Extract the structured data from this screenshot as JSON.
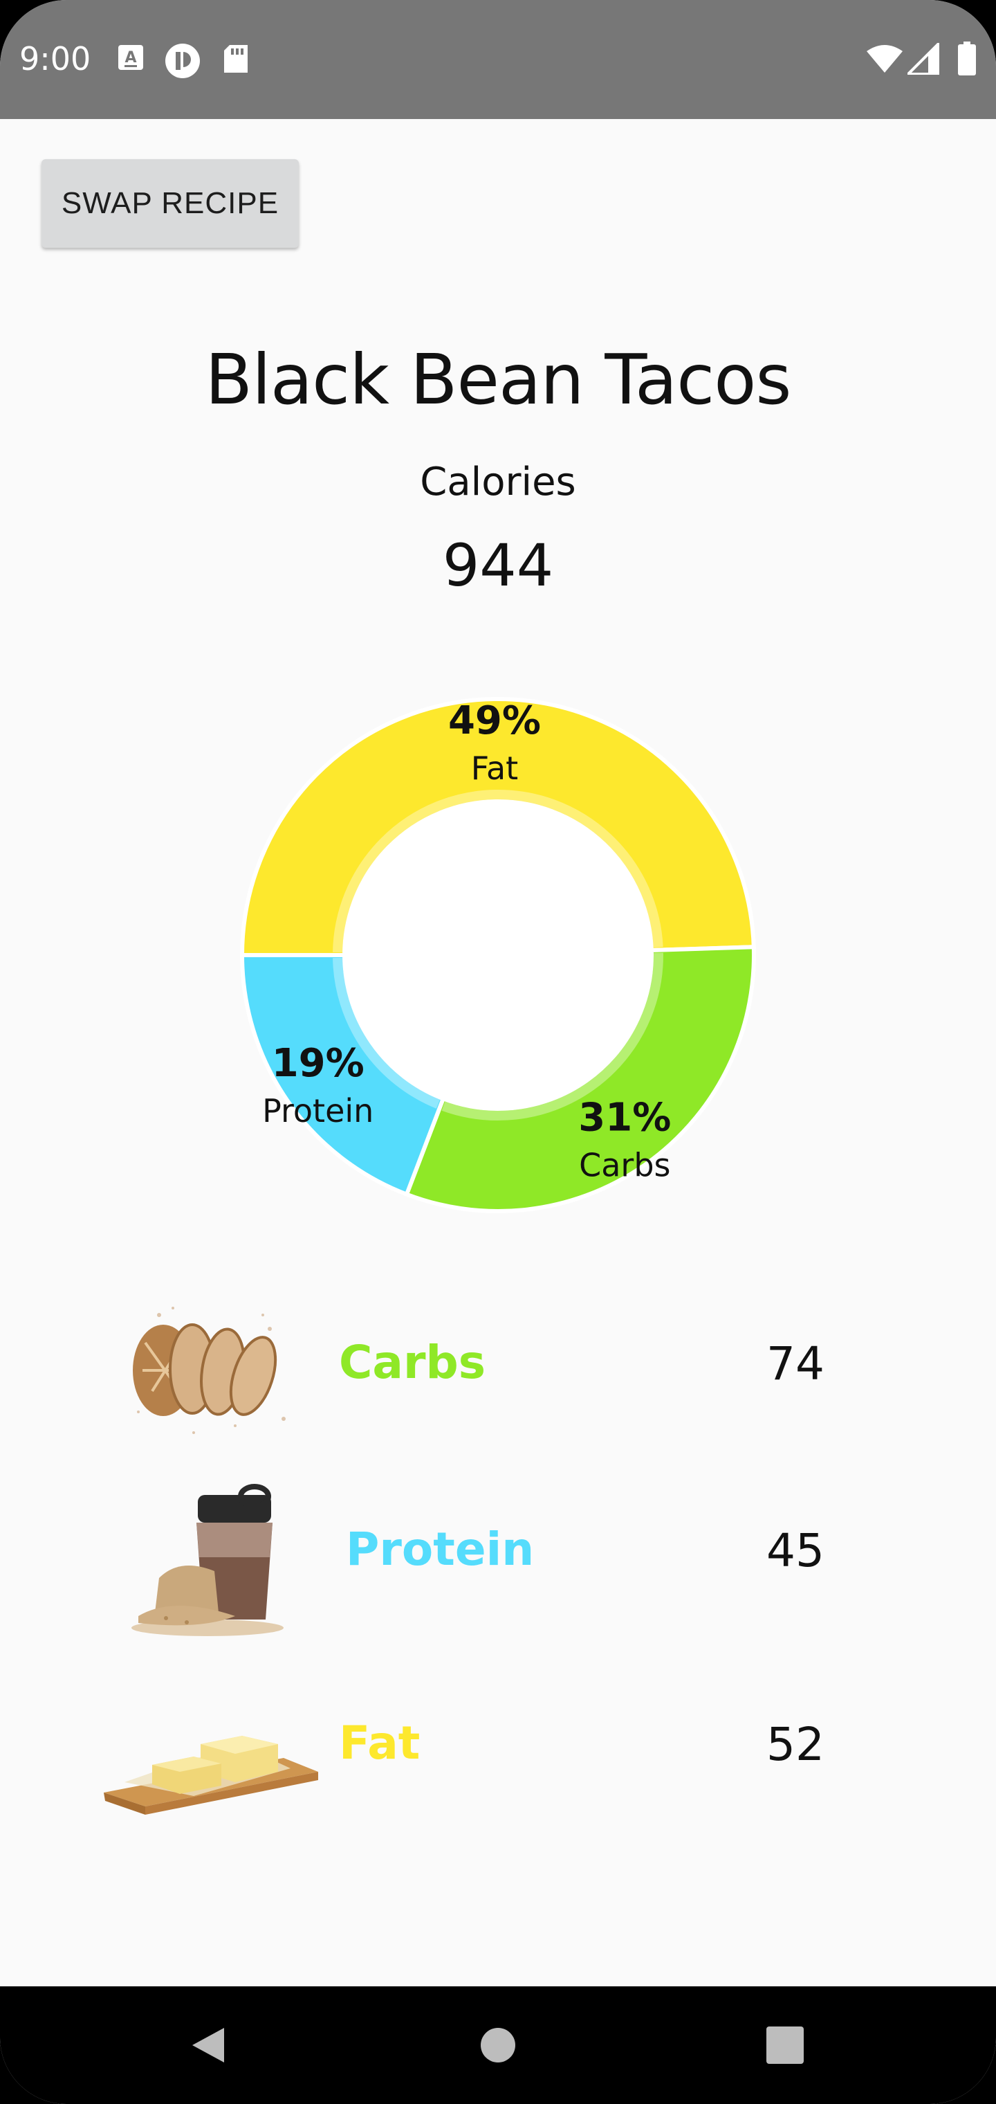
{
  "status_bar": {
    "time": "9:00",
    "icons": [
      "a-keyboard-icon",
      "privacy-icon",
      "sd-card-icon",
      "wifi-icon",
      "signal-icon",
      "battery-icon"
    ]
  },
  "toolbar": {
    "swap_label": "SWAP RECIPE"
  },
  "recipe": {
    "title": "Black Bean Tacos",
    "calories_label": "Calories",
    "calories_value": "944"
  },
  "chart_data": {
    "type": "pie",
    "slices": [
      {
        "label": "Fat",
        "value": 49,
        "pct_text": "49%",
        "color": "#fde82d"
      },
      {
        "label": "Carbs",
        "value": 31,
        "pct_text": "31%",
        "color": "#8fe827"
      },
      {
        "label": "Protein",
        "value": 19,
        "pct_text": "19%",
        "color": "#55dcfc"
      }
    ]
  },
  "macros": [
    {
      "name": "Carbs",
      "value": "74",
      "color": "#8fe827",
      "image": "bread-image"
    },
    {
      "name": "Protein",
      "value": "45",
      "color": "#55dcfc",
      "image": "protein-shaker-image"
    },
    {
      "name": "Fat",
      "value": "52",
      "color": "#fde82d",
      "image": "butter-image"
    }
  ],
  "nav": {
    "icons": [
      "back-icon",
      "home-icon",
      "recents-icon"
    ]
  }
}
